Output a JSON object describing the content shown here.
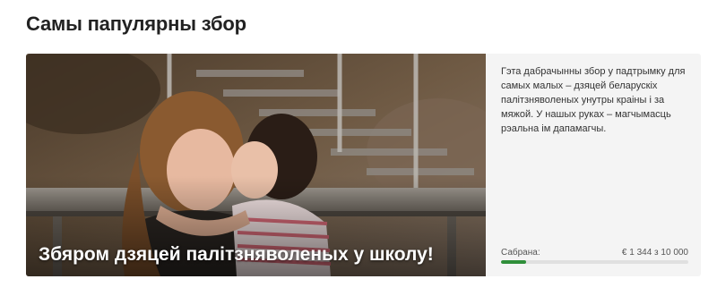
{
  "section": {
    "title": "Самы папулярны збор"
  },
  "campaign": {
    "title": "Збяром дзяцей палітзняволеных у школу!",
    "description": "Гэта дабрачынны збор у падтрымку для самых малых – дзяцей беларускіх палітзняволеных унутры краіны і за мяжой. У нашых руках – магчымасць рэальна ім дапамагчы.",
    "photo_alt": "photo",
    "progress": {
      "label": "Сабрана:",
      "amount_text": "€ 1 344 з 10 000",
      "collected": 1344,
      "goal": 10000,
      "fraction": 0.1344,
      "color": "#2f8f3a"
    }
  }
}
